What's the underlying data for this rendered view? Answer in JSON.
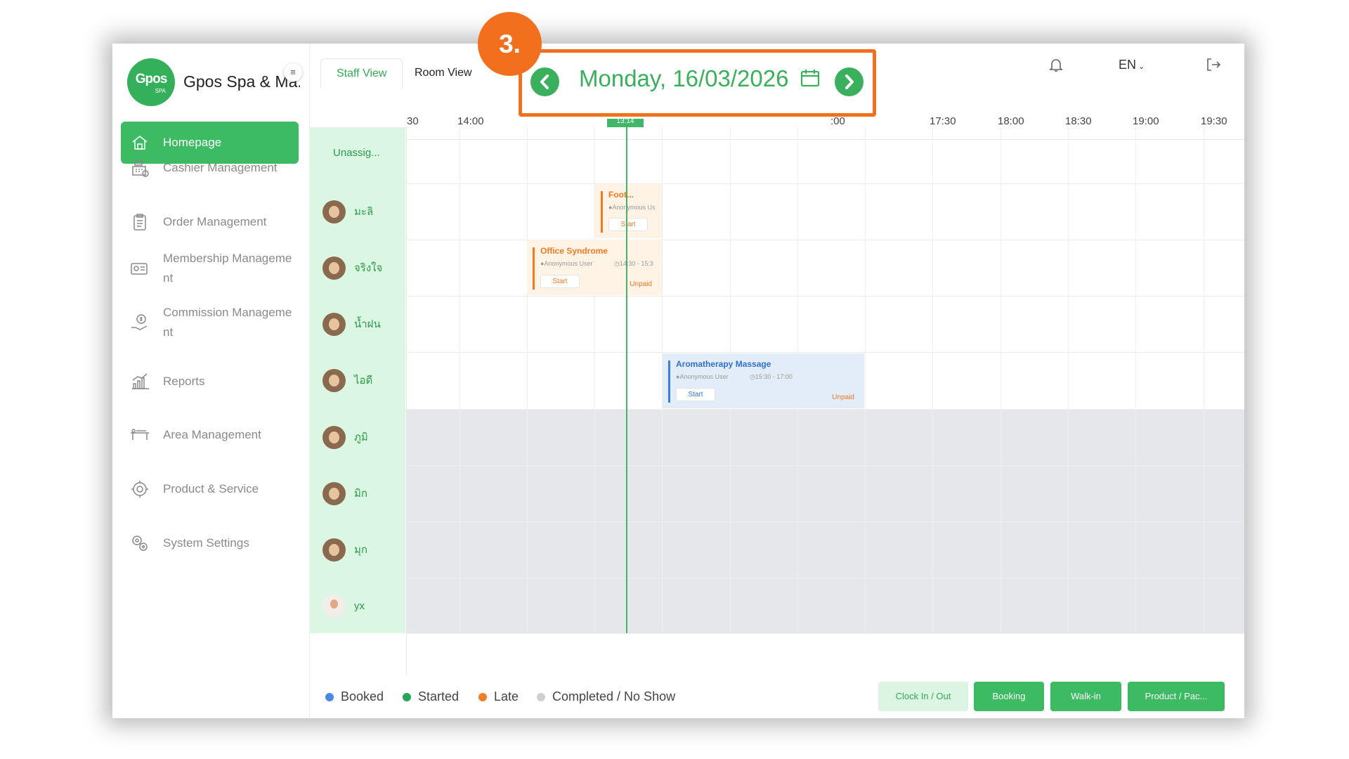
{
  "app": {
    "logo_main": "Gpos",
    "logo_sub": "SPA",
    "name": "Gpos Spa & Ma..",
    "collapse_icon": "menu-collapse-icon"
  },
  "sidebar": {
    "items": [
      {
        "label": "Homepage",
        "icon": "home-icon",
        "active": true
      },
      {
        "label": "Cashier Management",
        "icon": "cashier-icon"
      },
      {
        "label": "Order Management",
        "icon": "clipboard-icon"
      },
      {
        "label": "Membership Management",
        "line1": "Membership Manageme",
        "line2": "nt",
        "icon": "membership-card-icon"
      },
      {
        "label": "Commission Management",
        "line1": "Commission Manageme",
        "line2": "nt",
        "icon": "commission-icon"
      },
      {
        "label": "Reports",
        "icon": "reports-chart-icon"
      },
      {
        "label": "Area Management",
        "icon": "massage-bed-icon"
      },
      {
        "label": "Product & Service",
        "icon": "product-service-icon"
      },
      {
        "label": "System Settings",
        "icon": "gears-icon"
      }
    ]
  },
  "tabs": [
    {
      "label": "Staff View",
      "active": true
    },
    {
      "label": "Room View",
      "active": false
    }
  ],
  "date_nav": {
    "date": "Monday, 16/03/2026",
    "step_label": "3."
  },
  "header": {
    "language": "EN",
    "notification_icon": "bell-icon",
    "logout_icon": "logout-icon"
  },
  "timeline": {
    "ticks": [
      "30",
      "14:00",
      ":00",
      "17:30",
      "18:00",
      "18:30",
      "19:00",
      "19:30"
    ],
    "now_label": "13:14"
  },
  "staff": {
    "unassigned": "Unassig...",
    "members": [
      "มะลิ",
      "จริงใจ",
      "น้ำฝน",
      "ไอดี",
      "ภูมิ",
      "มิก",
      "มุก",
      "yx"
    ]
  },
  "bookings": [
    {
      "title": "Foot...",
      "user": "Anonymous Us",
      "time": "",
      "action": "Start",
      "payment": "",
      "color": "orange"
    },
    {
      "title": "Office Syndrome",
      "user": "Anonymous User",
      "time": "14:30 - 15:3",
      "action": "Start",
      "payment": "Unpaid",
      "color": "orange"
    },
    {
      "title": "Aromatherapy Massage",
      "user": "Anonymous User",
      "time": "15:30 - 17:00",
      "action": "Start",
      "payment": "Unpaid",
      "color": "blue"
    }
  ],
  "legend": [
    {
      "label": "Booked",
      "color": "#4a8ae6"
    },
    {
      "label": "Started",
      "color": "#26a65b"
    },
    {
      "label": "Late",
      "color": "#f27d2a"
    },
    {
      "label": "Completed / No Show",
      "color": "#cfcfcf"
    }
  ],
  "actions": {
    "clock": "Clock In / Out",
    "booking": "Booking",
    "walkin": "Walk-in",
    "product": "Product / Pac..."
  },
  "colors": {
    "brand_green": "#3dbb63",
    "highlight_orange": "#f26f1e",
    "staff_bg": "#dbf6e2",
    "unavailable_bg": "#e6e7eb"
  }
}
